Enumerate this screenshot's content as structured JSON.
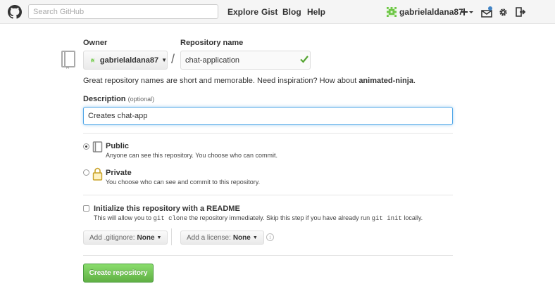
{
  "header": {
    "search_placeholder": "Search GitHub",
    "nav": [
      "Explore",
      "Gist",
      "Blog",
      "Help"
    ],
    "username": "gabrielaldana87",
    "icons": [
      "github-octocat-icon",
      "plus-icon",
      "notifications-icon",
      "gear-icon",
      "sign-out-icon"
    ]
  },
  "form": {
    "owner_label": "Owner",
    "owner_value": "gabrielaldana87",
    "slash": "/",
    "repo_label": "Repository name",
    "repo_value": "chat-application",
    "hint_prefix": "Great repository names are short and memorable. Need inspiration? How about ",
    "hint_suggestion": "animated-ninja",
    "hint_suffix": ".",
    "description_label": "Description",
    "description_optional": "(optional)",
    "description_value": "Creates chat-app",
    "public_title": "Public",
    "public_desc": "Anyone can see this repository. You choose who can commit.",
    "private_title": "Private",
    "private_desc": "You choose who can see and commit to this repository.",
    "visibility_selected": "Public",
    "readme_title": "Initialize this repository with a README",
    "readme_desc_1": "This will allow you to ",
    "readme_code_1": "git clone",
    "readme_desc_2": " the repository immediately. Skip this step if you have already run ",
    "readme_code_2": "git init",
    "readme_desc_3": " locally.",
    "readme_checked": false,
    "gitignore_label": "Add .gitignore:",
    "gitignore_value": "None",
    "license_label": "Add a license:",
    "license_value": "None",
    "info_glyph": "i",
    "create_label": "Create repository"
  },
  "colors": {
    "accent_blue": "#4183c4",
    "create_green": "#60b044",
    "notification_dot": "#4183c4",
    "avatar_green": "#6cc644"
  }
}
